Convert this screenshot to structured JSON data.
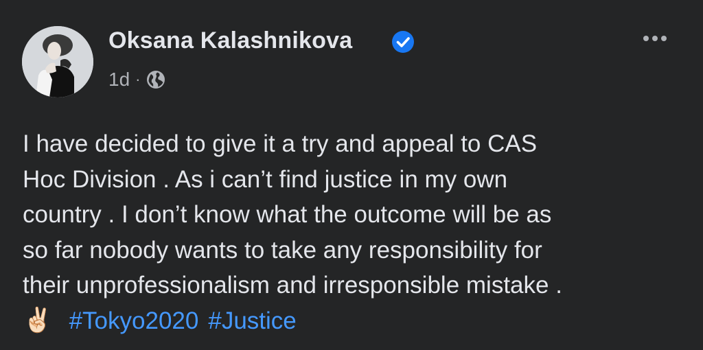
{
  "author": {
    "name": "Oksana Kalashnikova",
    "verified": true
  },
  "post": {
    "time": "1d",
    "separator": "·",
    "audience_icon": "globe-icon",
    "more_icon": "more-options-icon",
    "lines": [
      "I have decided to give it a try and appeal to CAS",
      "Hoc Division . As i can’t find justice in my own",
      "country . I don’t know what the outcome will be as",
      "so far nobody wants to take any responsibility for",
      "their unprofessionalism and irresponsible mistake ."
    ],
    "emoji": "✌🏻",
    "hashtags": [
      "#Tokyo2020",
      "#Justice"
    ]
  },
  "colors": {
    "background": "#242526",
    "text_primary": "#e4e6eb",
    "text_secondary": "#b0b3b8",
    "link": "#4599ff",
    "verified_badge": "#1877f2"
  }
}
